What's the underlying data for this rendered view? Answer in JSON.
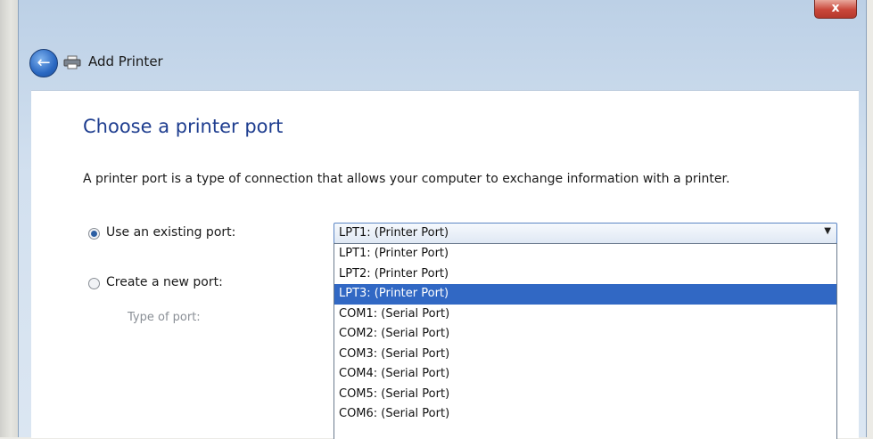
{
  "window": {
    "close_glyph": "x",
    "title": "Add Printer"
  },
  "heading": "Choose a printer port",
  "description": "A printer port is a type of connection that allows your computer to exchange information with a printer.",
  "options": {
    "existing_label": "Use an existing port:",
    "new_label": "Create a new port:",
    "type_label": "Type of port:"
  },
  "port_select": {
    "selected": "LPT1: (Printer Port)",
    "highlighted_index": 2,
    "items": [
      "LPT1: (Printer Port)",
      "LPT2: (Printer Port)",
      "LPT3: (Printer Port)",
      "COM1: (Serial Port)",
      "COM2: (Serial Port)",
      "COM3: (Serial Port)",
      "COM4: (Serial Port)",
      "COM5: (Serial Port)",
      "COM6: (Serial Port)"
    ]
  },
  "colors": {
    "accent": "#1e3d8f",
    "highlight": "#3168c4"
  }
}
